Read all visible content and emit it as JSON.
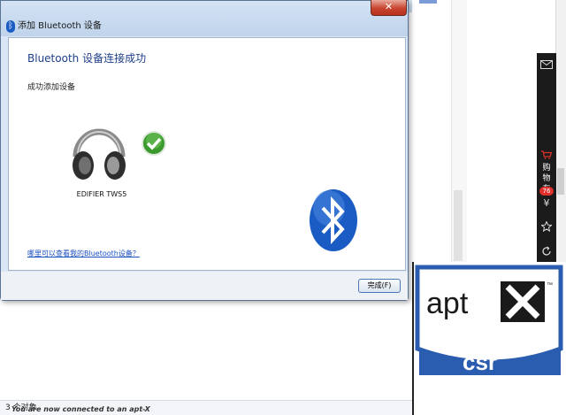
{
  "dialog": {
    "title": "添加 Bluetooth 设备",
    "close_label": "✕",
    "heading": "Bluetooth 设备连接成功",
    "subtext": "成功添加设备",
    "device_name": "EDIFIER TWS5",
    "help_link": "哪里可以查看我的Bluetooth设备？",
    "finish_button": "完成(F)"
  },
  "explorer": {
    "status_text": "3 个对象"
  },
  "side_toolbar": {
    "cart_label": "购\n物\n车",
    "cart_count": "76",
    "currency": "¥"
  },
  "aptx": {
    "brand": "aptX",
    "trademark": "™",
    "company": "csr",
    "caption": "You are now connected to an apt-X enabled"
  },
  "icons": [
    "bluetooth-icon",
    "headphones-icon",
    "checkmark-icon",
    "close-icon",
    "mail-icon",
    "cart-icon",
    "star-icon",
    "refresh-icon"
  ],
  "colors": {
    "accent_blue": "#1e3f8a",
    "link_blue": "#1a4fc0",
    "close_red": "#c7442e",
    "aptx_blue": "#2a5db0"
  }
}
